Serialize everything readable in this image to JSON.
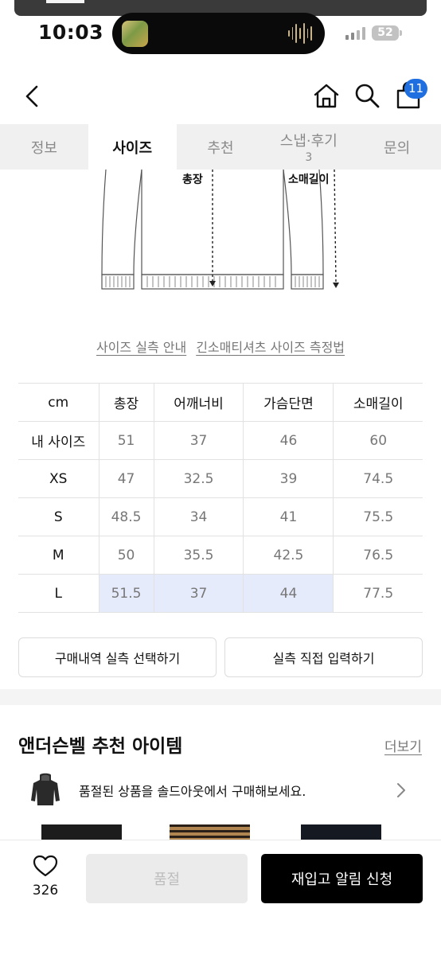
{
  "status_bar": {
    "time": "10:03",
    "battery": "52"
  },
  "header": {
    "cart_badge": "11"
  },
  "tabs": [
    {
      "label": "정보",
      "sub": ""
    },
    {
      "label": "사이즈",
      "sub": ""
    },
    {
      "label": "추천",
      "sub": ""
    },
    {
      "label": "스냅·후기",
      "sub": "3"
    },
    {
      "label": "문의",
      "sub": ""
    }
  ],
  "diagram": {
    "length_label": "총장",
    "sleeve_label": "소매길이"
  },
  "guide_links": {
    "size_guide": "사이즈 실측 안내",
    "measure_method": "긴소매티셔츠 사이즈 측정법"
  },
  "size_table": {
    "headers": [
      "cm",
      "총장",
      "어깨너비",
      "가슴단면",
      "소매길이"
    ],
    "rows": [
      [
        "내 사이즈",
        "51",
        "37",
        "46",
        "60"
      ],
      [
        "XS",
        "47",
        "32.5",
        "39",
        "74.5"
      ],
      [
        "S",
        "48.5",
        "34",
        "41",
        "75.5"
      ],
      [
        "M",
        "50",
        "35.5",
        "42.5",
        "76.5"
      ],
      [
        "L",
        "51.5",
        "37",
        "44",
        "77.5"
      ]
    ]
  },
  "actions": {
    "select_history": "구매내역 실측 선택하기",
    "direct_input": "실측 직접 입력하기"
  },
  "recommend": {
    "title": "앤더슨벨 추천 아이템",
    "more": "더보기",
    "soldout_banner": "품절된 상품을 솔드아웃에서 구매해보세요."
  },
  "bottom_bar": {
    "like_count": "326",
    "soldout_label": "품절",
    "restock_label": "재입고 알림 신청"
  },
  "colors": {
    "accent_blue": "#1f6fe0",
    "highlight": "#e5ebfb",
    "black": "#000000"
  }
}
